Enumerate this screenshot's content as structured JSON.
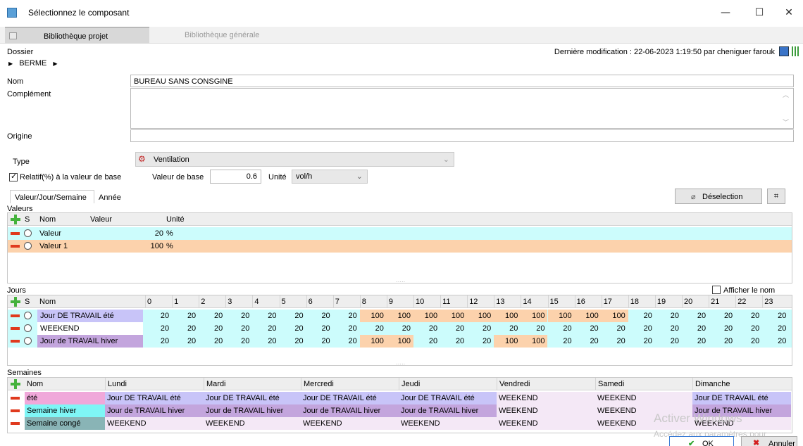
{
  "window": {
    "title": "Sélectionnez le composant",
    "minimize": "—",
    "maximize": "☐",
    "close": "✕"
  },
  "tabs": {
    "project": "Bibliothèque projet",
    "general": "Bibliothèque générale"
  },
  "dossier": {
    "label": "Dossier",
    "path": "BERME"
  },
  "modified": "Dernière modification : 22-06-2023 1:19:50 par cheniguer farouk",
  "form": {
    "nom_label": "Nom",
    "nom_value": "BUREAU SANS CONSGINE",
    "complement_label": "Complément",
    "origine_label": "Origine",
    "type_label": "Type",
    "type_value": "Ventilation",
    "relatif_label": "Relatif(%) à la valeur de base",
    "valeur_base_label": "Valeur de base",
    "valeur_base_value": "0.6",
    "unite_label": "Unité",
    "unite_value": "vol/h"
  },
  "subtabs": {
    "vjs": "Valeur/Jour/Semaine",
    "annee": "Année"
  },
  "deselection": "Déselection",
  "valeurs": {
    "section": "Valeurs",
    "headers": {
      "s": "S",
      "nom": "Nom",
      "valeur": "Valeur",
      "unite": "Unité"
    },
    "rows": [
      {
        "nom": "Valeur",
        "valeur": "20",
        "unite": "%",
        "color": "#ccfcfc"
      },
      {
        "nom": "Valeur 1",
        "valeur": "100",
        "unite": "%",
        "color": "#fcd2ac"
      }
    ]
  },
  "jours": {
    "section": "Jours",
    "afficher": "Afficher le nom",
    "headers": {
      "s": "S",
      "nom": "Nom"
    },
    "hours": [
      "0",
      "1",
      "2",
      "3",
      "4",
      "5",
      "6",
      "7",
      "8",
      "9",
      "10",
      "11",
      "12",
      "13",
      "14",
      "15",
      "16",
      "17",
      "18",
      "19",
      "20",
      "21",
      "22",
      "23"
    ],
    "rows": [
      {
        "nom": "Jour DE TRAVAIL été",
        "nomcolor": "#c8c4f8",
        "values": [
          "20",
          "20",
          "20",
          "20",
          "20",
          "20",
          "20",
          "20",
          "100",
          "100",
          "100",
          "100",
          "100",
          "100",
          "100",
          "100",
          "100",
          "100",
          "20",
          "20",
          "20",
          "20",
          "20",
          "20"
        ]
      },
      {
        "nom": "WEEKEND",
        "nomcolor": "#fff",
        "values": [
          "20",
          "20",
          "20",
          "20",
          "20",
          "20",
          "20",
          "20",
          "20",
          "20",
          "20",
          "20",
          "20",
          "20",
          "20",
          "20",
          "20",
          "20",
          "20",
          "20",
          "20",
          "20",
          "20",
          "20"
        ]
      },
      {
        "nom": "Jour de TRAVAIL hiver",
        "nomcolor": "#c3a5dd",
        "values": [
          "20",
          "20",
          "20",
          "20",
          "20",
          "20",
          "20",
          "20",
          "100",
          "100",
          "20",
          "20",
          "20",
          "100",
          "100",
          "20",
          "20",
          "20",
          "20",
          "20",
          "20",
          "20",
          "20",
          "20"
        ]
      }
    ]
  },
  "semaines": {
    "section": "Semaines",
    "headers": [
      "Nom",
      "Lundi",
      "Mardi",
      "Mercredi",
      "Jeudi",
      "Vendredi",
      "Samedi",
      "Dimanche"
    ],
    "rows": [
      {
        "nom": "été",
        "nomcolor": "#f0a8da",
        "days": [
          "Jour DE TRAVAIL été",
          "Jour DE TRAVAIL été",
          "Jour DE TRAVAIL été",
          "Jour DE TRAVAIL été",
          "WEEKEND",
          "WEEKEND",
          "Jour DE TRAVAIL été"
        ]
      },
      {
        "nom": "Semaine hiver",
        "nomcolor": "#7ff6f6",
        "days": [
          "Jour de TRAVAIL hiver",
          "Jour de TRAVAIL hiver",
          "Jour de TRAVAIL hiver",
          "Jour de TRAVAIL hiver",
          "WEEKEND",
          "WEEKEND",
          "Jour de TRAVAIL hiver"
        ]
      },
      {
        "nom": "Semaine congé",
        "nomcolor": "#89b4b6",
        "days": [
          "WEEKEND",
          "WEEKEND",
          "WEEKEND",
          "WEEKEND",
          "WEEKEND",
          "WEEKEND",
          "WEEKEND"
        ]
      }
    ]
  },
  "watermark": {
    "line1": "Activer Windows",
    "line2": "Accédez aux paramètres pour"
  },
  "buttons": {
    "ok": "OK",
    "annuler": "Annuler"
  },
  "colors": {
    "cyan": "#ccfcfc",
    "orange": "#fcd2ac",
    "weekend": "#f4e8f6",
    "ete": "#c8c4f8",
    "hiver": "#c3a5dd"
  }
}
